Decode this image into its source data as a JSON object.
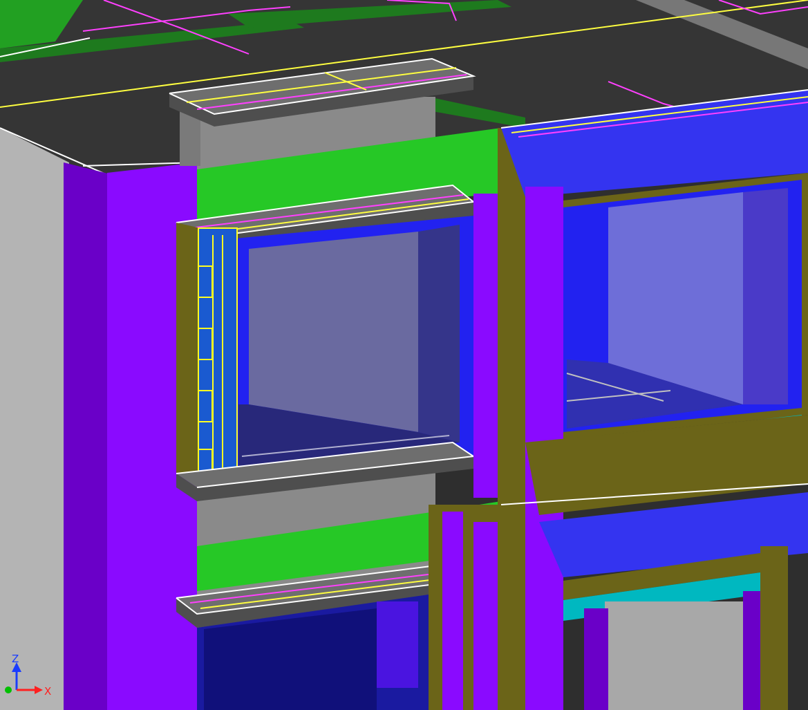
{
  "viewport": {
    "axis_triad": {
      "z_label": "Z",
      "x_label": "X",
      "z_color": "#1a3cff",
      "x_color": "#ff2020",
      "y_color": "#00c000"
    }
  },
  "colors": {
    "roof": "#353535",
    "wall_purple": "#8a0aff",
    "wall_purple_dark": "#6a00c8",
    "wall_grey": "#b4b4b4",
    "slab_top": "#6e6e6e",
    "slab_dark": "#4e4e4e",
    "column_grey": "#8a8a8a",
    "beam_green": "#26c826",
    "frame_olive": "#6b6418",
    "frame_blue": "#2222f0",
    "glass": "#6a6aa0",
    "glass_right": "#6e6ed8",
    "panel_blue": "#3434f0",
    "sill_cyan": "#00b8c0",
    "selection_yellow": "#ffff20",
    "grid_magenta": "#ff40ff",
    "grid_yellow": "#ffff40",
    "edge_white": "#ffffff"
  }
}
